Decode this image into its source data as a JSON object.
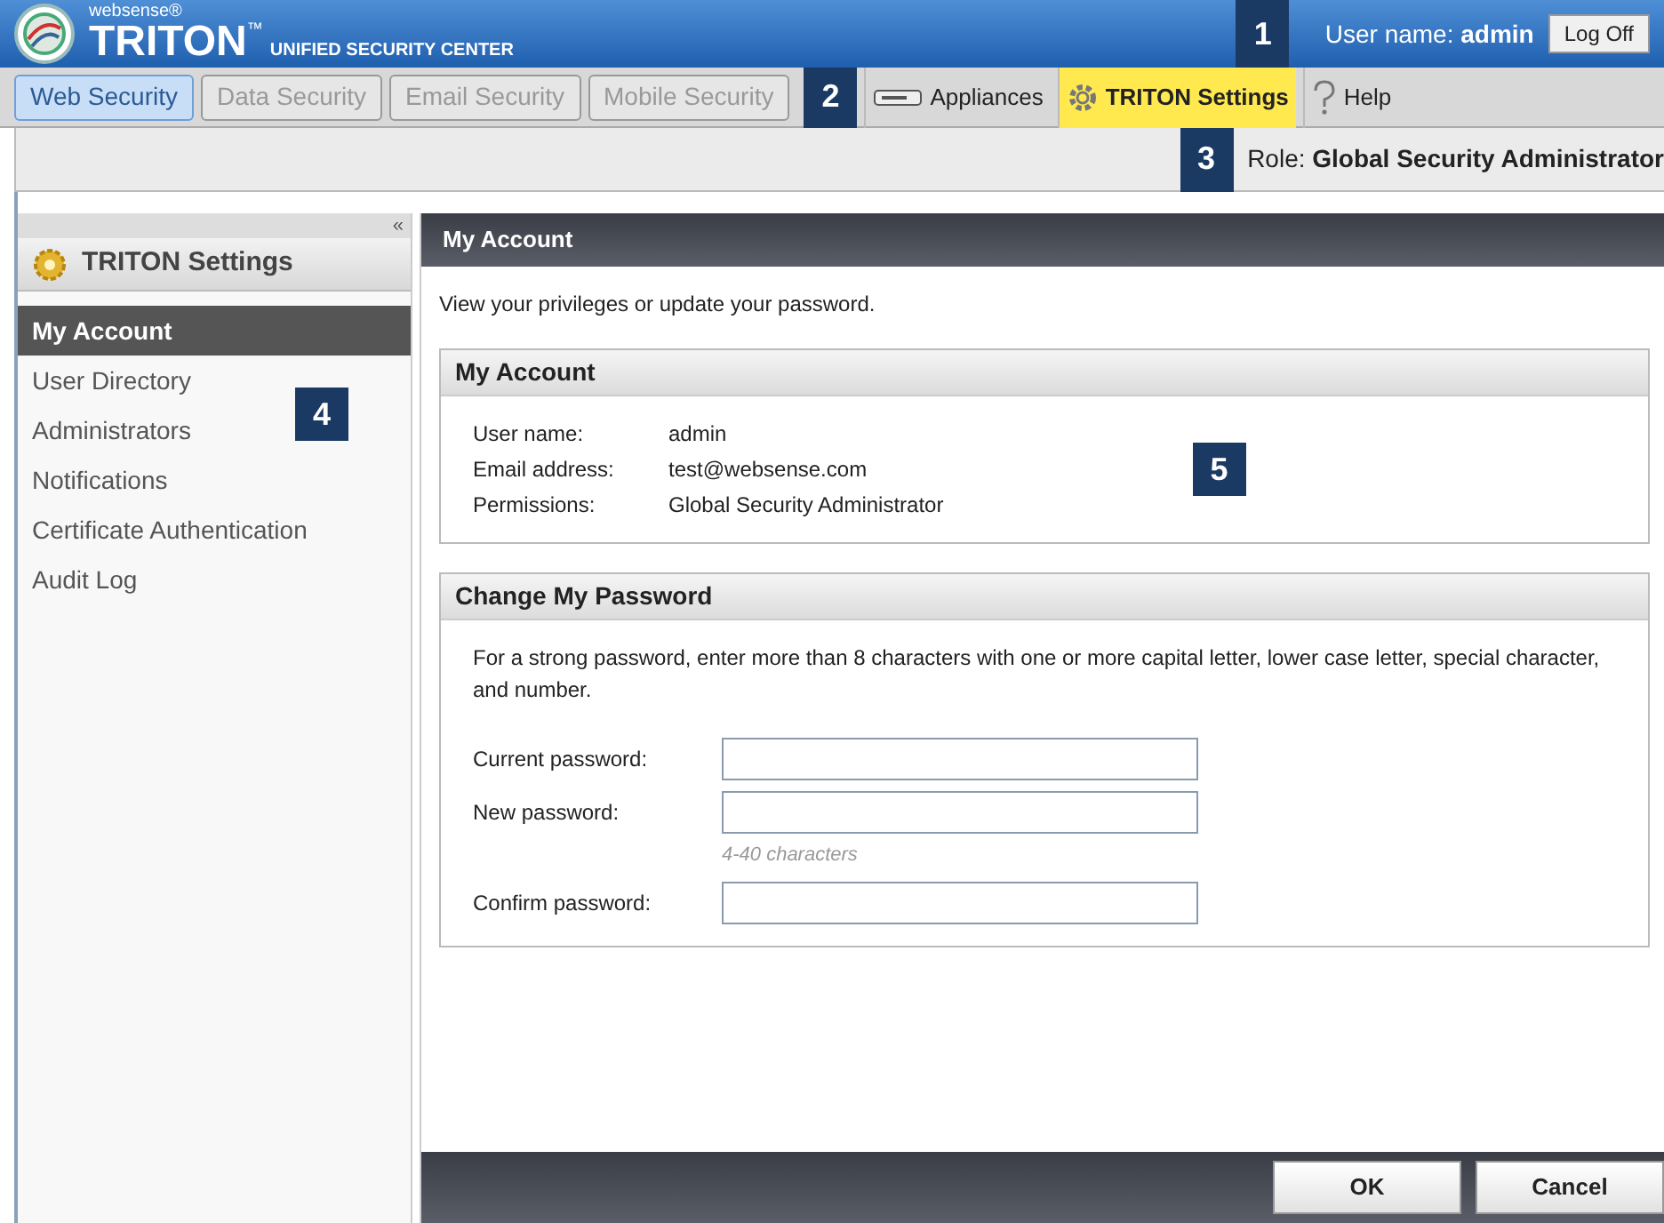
{
  "header": {
    "brand_small": "websense®",
    "brand": "TRITON",
    "brand_tm": "™",
    "brand_sub": "UNIFIED SECURITY CENTER",
    "callout": "1",
    "user_label": "User name:",
    "user_name": "admin",
    "logoff": "Log Off"
  },
  "modules": [
    {
      "label": "Web Security",
      "selected": true
    },
    {
      "label": "Data Security",
      "selected": false
    },
    {
      "label": "Email Security",
      "selected": false
    },
    {
      "label": "Mobile Security",
      "selected": false
    }
  ],
  "module_callout": "2",
  "toolbar": [
    {
      "kind": "appliances",
      "label": "Appliances",
      "selected": false
    },
    {
      "kind": "settings",
      "label": "TRITON Settings",
      "selected": true
    },
    {
      "kind": "help",
      "label": "Help",
      "selected": false
    }
  ],
  "role": {
    "callout": "3",
    "label": "Role:",
    "value": "Global Security Administrator"
  },
  "sidebar": {
    "collapse": "«",
    "title": "TRITON Settings",
    "callout": "4",
    "items": [
      {
        "label": "My Account",
        "selected": true
      },
      {
        "label": "User Directory",
        "selected": false
      },
      {
        "label": "Administrators",
        "selected": false
      },
      {
        "label": "Notifications",
        "selected": false
      },
      {
        "label": "Certificate Authentication",
        "selected": false
      },
      {
        "label": "Audit Log",
        "selected": false
      }
    ]
  },
  "page": {
    "title": "My Account",
    "intro": "View your privileges or update your password.",
    "account": {
      "title": "My Account",
      "callout": "5",
      "rows": [
        {
          "label": "User name:",
          "value": "admin"
        },
        {
          "label": "Email address:",
          "value": "test@websense.com"
        },
        {
          "label": "Permissions:",
          "value": "Global Security Administrator"
        }
      ]
    },
    "password": {
      "title": "Change My Password",
      "note": "For a strong password, enter more than 8 characters with one or more capital letter, lower case letter, special character, and number.",
      "fields": [
        {
          "label": "Current password:"
        },
        {
          "label": "New password:",
          "hint": "4-40 characters"
        },
        {
          "label": "Confirm password:"
        }
      ]
    },
    "buttons": [
      "OK",
      "Cancel"
    ]
  }
}
